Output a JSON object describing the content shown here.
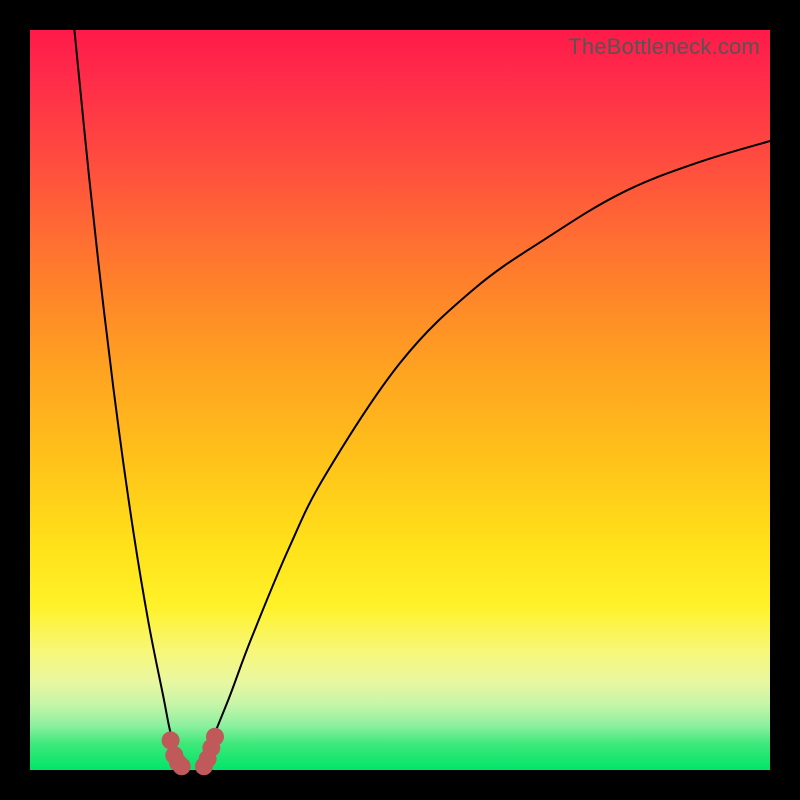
{
  "watermark": "TheBottleneck.com",
  "chart_data": {
    "type": "line",
    "title": "",
    "xlabel": "",
    "ylabel": "",
    "xlim": [
      0,
      100
    ],
    "ylim": [
      0,
      100
    ],
    "series": [
      {
        "name": "curve-left",
        "x": [
          6,
          8,
          10,
          12,
          14,
          16,
          18,
          19,
          20,
          20.5,
          21
        ],
        "y": [
          100,
          80,
          62,
          46,
          32,
          20,
          10,
          5,
          2,
          1,
          0
        ]
      },
      {
        "name": "curve-right",
        "x": [
          23,
          23.5,
          24,
          25,
          27,
          30,
          35,
          40,
          50,
          60,
          70,
          80,
          90,
          100
        ],
        "y": [
          0,
          1,
          2,
          5,
          10,
          18,
          30,
          40,
          55,
          65,
          72,
          78,
          82,
          85
        ]
      }
    ],
    "markers": {
      "name": "bottom-cluster",
      "color": "#c05a5a",
      "points": [
        {
          "x": 19.0,
          "y": 4.0
        },
        {
          "x": 19.5,
          "y": 2.0
        },
        {
          "x": 20.0,
          "y": 1.0
        },
        {
          "x": 20.5,
          "y": 0.5
        },
        {
          "x": 23.5,
          "y": 0.5
        },
        {
          "x": 24.0,
          "y": 1.5
        },
        {
          "x": 24.5,
          "y": 3.0
        },
        {
          "x": 25.0,
          "y": 4.5
        }
      ]
    }
  }
}
